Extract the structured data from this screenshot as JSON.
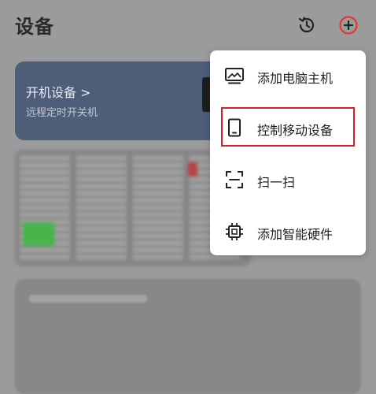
{
  "header": {
    "title": "设备",
    "history_icon": "history-icon",
    "add_icon": "add-circle-icon",
    "add_icon_color": "#e5392f"
  },
  "power_card": {
    "title": "开机设备 >",
    "subtitle": "远程定时开关机",
    "background": "#4e5d78"
  },
  "menu": {
    "items": [
      {
        "label": "添加电脑主机",
        "icon": "computer-icon"
      },
      {
        "label": "控制移动设备",
        "icon": "mobile-device-icon"
      },
      {
        "label": "扫一扫",
        "icon": "scan-icon"
      },
      {
        "label": "添加智能硬件",
        "icon": "chip-icon"
      }
    ],
    "highlight_color": "#d2232a"
  }
}
